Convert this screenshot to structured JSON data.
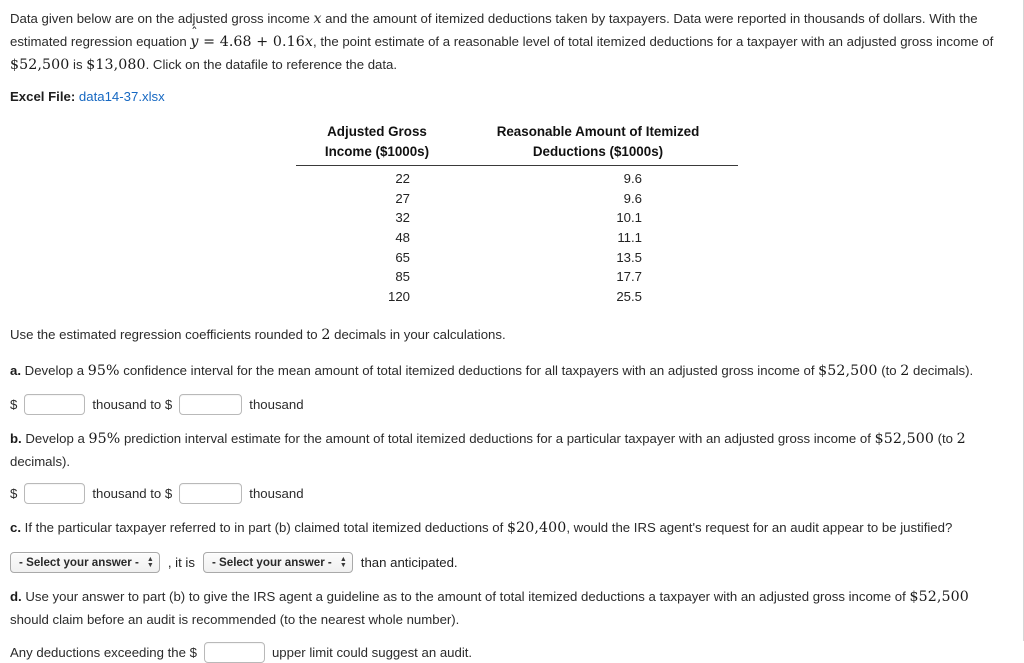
{
  "intro": {
    "line1_a": "Data given below are on the adjusted gross income ",
    "var_x": "x",
    "line1_b": " and the amount of itemized deductions taken by taxpayers. Data were reported in thousands of dollars.",
    "line2_a": "With the estimated regression equation ",
    "equation": "y = 4.68 + 0.16x",
    "eq_yhat": "y",
    "eq_rest": "= 4.68 + 0.16",
    "eq_x": "x",
    "line2_b": ", the point estimate of a reasonable level of total itemized deductions for a taxpayer with an adjusted gross income of ",
    "income_value": "$52,500",
    "line2_c": " is ",
    "estimate_value": "$13,080",
    "line2_d": ". Click on the datafile to reference the data."
  },
  "excel": {
    "label": "Excel File:",
    "filename": "data14-37.xlsx"
  },
  "table": {
    "headers": {
      "col1_line1": "Adjusted Gross",
      "col1_line2": "Income ($1000s)",
      "col2_line1": "Reasonable Amount of Itemized",
      "col2_line2": "Deductions ($1000s)"
    },
    "rows": [
      {
        "income": "22",
        "deductions": "9.6"
      },
      {
        "income": "27",
        "deductions": "9.6"
      },
      {
        "income": "32",
        "deductions": "10.1"
      },
      {
        "income": "48",
        "deductions": "11.1"
      },
      {
        "income": "65",
        "deductions": "13.5"
      },
      {
        "income": "85",
        "deductions": "17.7"
      },
      {
        "income": "120",
        "deductions": "25.5"
      }
    ]
  },
  "instruction": {
    "pre": "Use the estimated regression coefficients rounded to ",
    "decimals": "2",
    "post": " decimals in your calculations."
  },
  "parts": {
    "a": {
      "label": "a.",
      "text_1": " Develop a ",
      "pct": "95%",
      "text_2": " confidence interval for the mean amount of total itemized deductions for all taxpayers with an adjusted gross income of ",
      "income": "$52,500",
      "text_3": " (to ",
      "decimals": "2",
      "text_4": " decimals).",
      "dollar": "$",
      "mid_text": "thousand to $",
      "end_text": "thousand",
      "input1_value": "",
      "input2_value": ""
    },
    "b": {
      "label": "b.",
      "text_1": " Develop a ",
      "pct": "95%",
      "text_2": " prediction interval estimate for the amount of total itemized deductions for a particular taxpayer with an adjusted gross income of ",
      "income": "$52,500",
      "text_3": " (to ",
      "decimals": "2",
      "text_4": " decimals).",
      "dollar": "$",
      "mid_text": "thousand to $",
      "end_text": "thousand",
      "input1_value": "",
      "input2_value": ""
    },
    "c": {
      "label": "c.",
      "text_1": " If the particular taxpayer referred to in part (b) claimed total itemized deductions of ",
      "claimed": "$20,400",
      "text_2": ", would the IRS agent's request for an audit appear to be justified?",
      "select1_value": "- Select your answer -",
      "mid_text": ", it is",
      "select2_value": "- Select your answer -",
      "tail_text": "than anticipated."
    },
    "d": {
      "label": "d.",
      "text_1": " Use your answer to part (b) to give the IRS agent a guideline as to the amount of total itemized deductions a taxpayer with an adjusted gross income of ",
      "income": "$52,500",
      "text_2": " should claim before an audit is recommended (to the nearest whole number).",
      "prefix": "Any deductions exceeding the $",
      "input_value": "",
      "suffix": "upper limit could suggest an audit."
    }
  }
}
